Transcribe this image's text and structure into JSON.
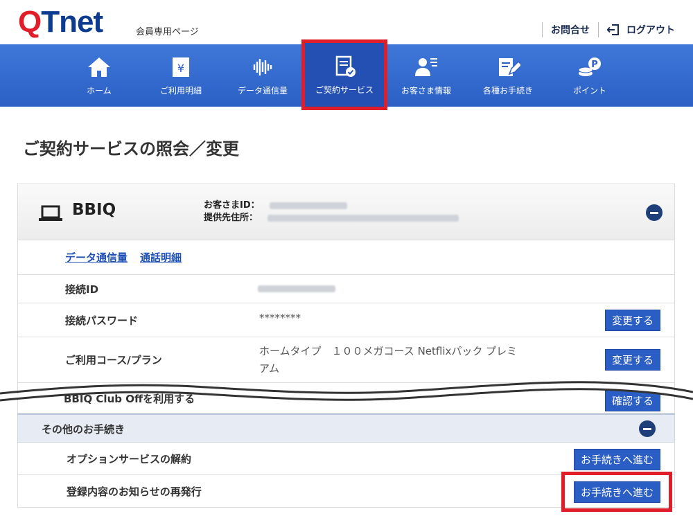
{
  "header": {
    "logo_q": "Q",
    "logo_t": "Tnet",
    "member_page": "会員専用ページ",
    "contact": "お問合せ",
    "logout": "ログアウト"
  },
  "nav": [
    {
      "label": "ホーム",
      "icon": "home-icon"
    },
    {
      "label": "ご利用明細",
      "icon": "yen-bill-icon"
    },
    {
      "label": "データ通信量",
      "icon": "sound-wave-icon"
    },
    {
      "label": "ご契約サービス",
      "icon": "contract-check-icon"
    },
    {
      "label": "お客さま情報",
      "icon": "user-list-icon"
    },
    {
      "label": "各種お手続き",
      "icon": "form-pen-icon"
    },
    {
      "label": "ポイント",
      "icon": "coins-point-icon"
    }
  ],
  "page_title": "ご契約サービスの照会／変更",
  "panel": {
    "name": "BBIQ",
    "customer_id_label": "お客さまID：",
    "address_label": "提供先住所：",
    "links": [
      "データ通信量",
      "通話明細"
    ],
    "rows": [
      {
        "label": "接続ID",
        "value": ""
      },
      {
        "label": "接続パスワード",
        "value": "********",
        "button": "変更する"
      },
      {
        "label": "ご利用コース/プラン",
        "value": "ホームタイプ　１００メガコース Netflixパック プレミアム",
        "button": "変更する"
      },
      {
        "label": "BBIQ Club Offを利用する",
        "button": "確認する"
      }
    ]
  },
  "other": {
    "title": "その他のお手続き",
    "rows": [
      {
        "label": "オプションサービスの解約",
        "button": "お手続きへ進む"
      },
      {
        "label": "登録内容のお知らせの再発行",
        "button": "お手続きへ進む"
      }
    ]
  },
  "colors": {
    "brand_red": "#e01e2a",
    "brand_blue": "#2b5fc4",
    "navy": "#1e3f7a"
  }
}
